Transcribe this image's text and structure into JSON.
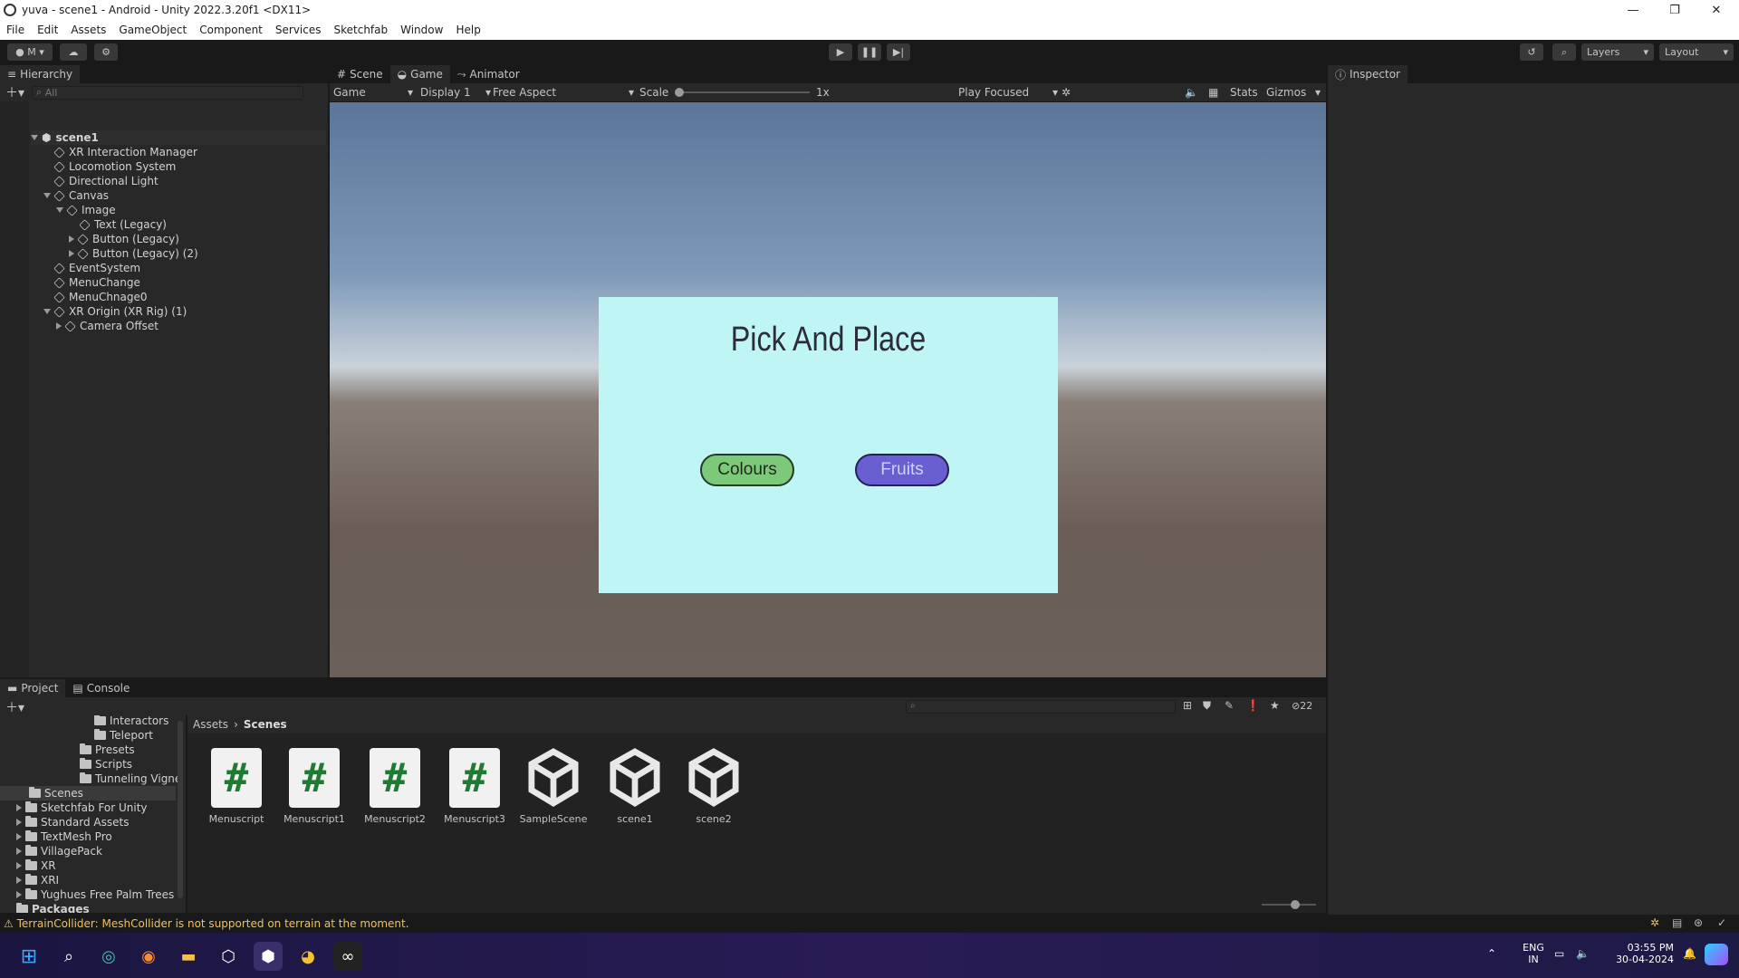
{
  "window": {
    "title": "yuva - scene1 - Android - Unity 2022.3.20f1 <DX11>",
    "controls": [
      "—",
      "❐",
      "✕"
    ]
  },
  "menu": [
    "File",
    "Edit",
    "Assets",
    "GameObject",
    "Component",
    "Services",
    "Sketchfab",
    "Window",
    "Help"
  ],
  "toolbar": {
    "account": "M",
    "layers": "Layers",
    "layout": "Layout"
  },
  "hierarchy": {
    "tab": "Hierarchy",
    "search_placeholder": "All",
    "scene": "scene1",
    "items": [
      {
        "label": "XR Interaction Manager"
      },
      {
        "label": "Locomotion System"
      },
      {
        "label": "Directional Light"
      },
      {
        "label": "Canvas"
      },
      {
        "label": "Image"
      },
      {
        "label": "Text (Legacy)"
      },
      {
        "label": "Button (Legacy)"
      },
      {
        "label": "Button (Legacy) (2)"
      },
      {
        "label": "EventSystem"
      },
      {
        "label": "MenuChange"
      },
      {
        "label": "MenuChnage0"
      },
      {
        "label": "XR Origin (XR Rig) (1)"
      },
      {
        "label": "Camera Offset"
      }
    ]
  },
  "center_tabs": [
    "Scene",
    "Game",
    "Animator"
  ],
  "gamebar": {
    "mode": "Game",
    "display": "Display 1",
    "aspect": "Free Aspect",
    "scale_label": "Scale",
    "scale_value": "1x",
    "play_mode": "Play Focused",
    "stats": "Stats",
    "gizmos": "Gizmos"
  },
  "game_view": {
    "title": "Pick And Place",
    "button_colours": "Colours",
    "button_fruits": "Fruits",
    "colours": {
      "panel": "#c0f5f6",
      "green": "#7dc97a",
      "purple": "#6a5fd0"
    }
  },
  "inspector": {
    "tab": "Inspector"
  },
  "bottom_tabs": [
    "Project",
    "Console"
  ],
  "project": {
    "hidden_count": "22",
    "breadcrumb": [
      "Assets",
      "Scenes"
    ],
    "tree": [
      {
        "label": "Interactors"
      },
      {
        "label": "Teleport"
      },
      {
        "label": "Presets"
      },
      {
        "label": "Scripts"
      },
      {
        "label": "Tunneling Vigne"
      },
      {
        "label": "Scenes"
      },
      {
        "label": "Sketchfab For Unity"
      },
      {
        "label": "Standard Assets"
      },
      {
        "label": "TextMesh Pro"
      },
      {
        "label": "VillagePack"
      },
      {
        "label": "XR"
      },
      {
        "label": "XRI"
      },
      {
        "label": "Yughues Free Palm Trees"
      },
      {
        "label": "Packages"
      }
    ],
    "assets": [
      {
        "name": "Menuscript",
        "kind": "script"
      },
      {
        "name": "Menuscript1",
        "kind": "script"
      },
      {
        "name": "Menuscript2",
        "kind": "script"
      },
      {
        "name": "Menuscript3",
        "kind": "script"
      },
      {
        "name": "SampleScene",
        "kind": "scene"
      },
      {
        "name": "scene1",
        "kind": "scene"
      },
      {
        "name": "scene2",
        "kind": "scene"
      }
    ]
  },
  "status": {
    "warning": "TerrainCollider: MeshCollider is not supported on terrain at the moment."
  },
  "taskbar": {
    "lang1": "ENG",
    "lang2": "IN",
    "time": "03:55 PM",
    "date": "30-04-2024"
  }
}
